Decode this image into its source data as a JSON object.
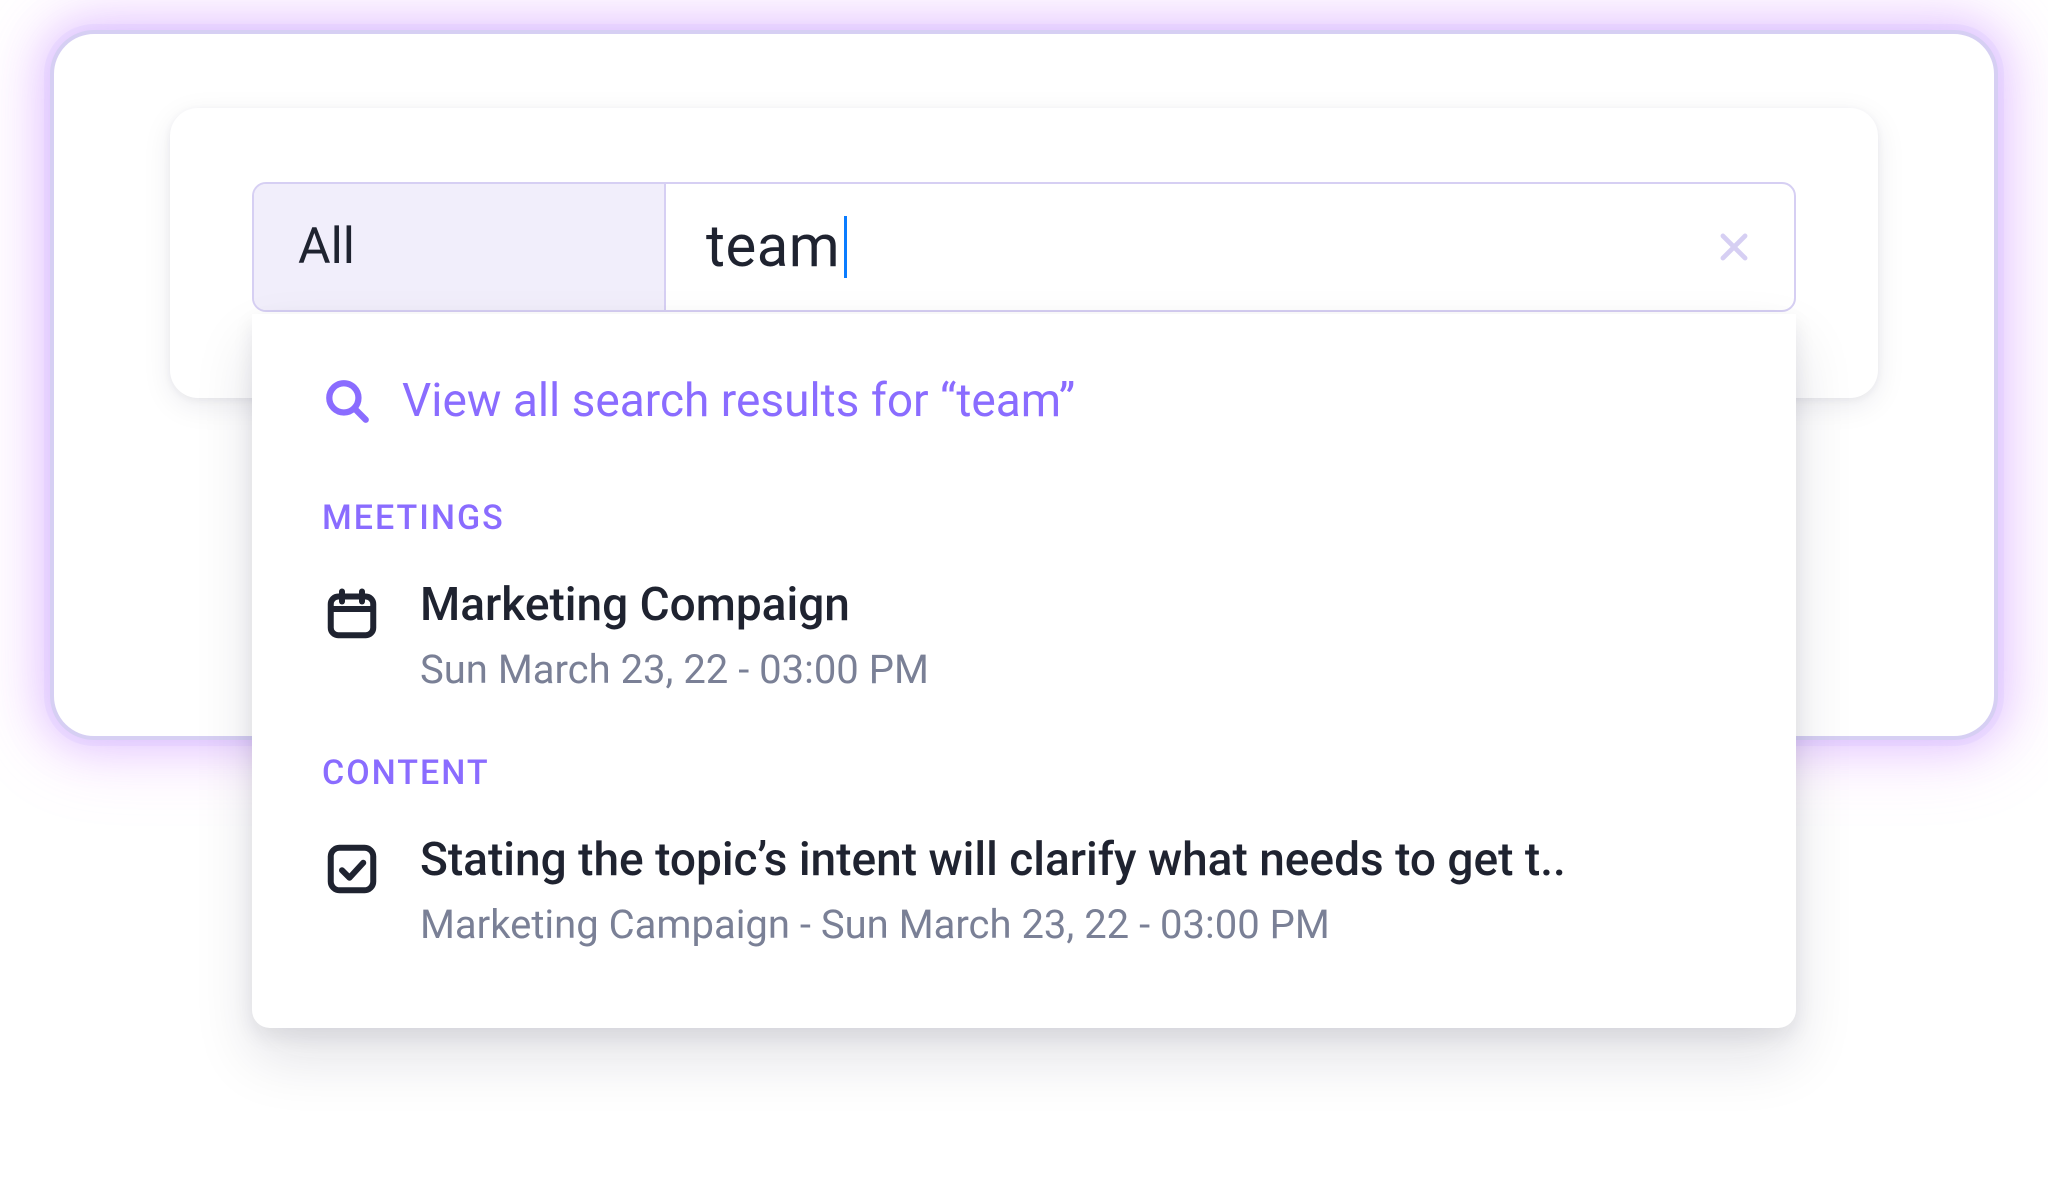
{
  "search": {
    "scope_label": "All",
    "query": "team",
    "view_all_label": "View all search results for “team”"
  },
  "sections": {
    "meetings": {
      "label": "MEETINGS",
      "items": [
        {
          "icon": "calendar-icon",
          "title": "Marketing Compaign",
          "subtitle": "Sun March 23, 22 - 03:00 PM"
        }
      ]
    },
    "content": {
      "label": "CONTENT",
      "items": [
        {
          "icon": "check-square-icon",
          "title": "Stating the topic’s intent will clarify what needs to get t..",
          "subtitle": "Marketing Campaign - Sun March 23, 22 - 03:00 PM"
        }
      ]
    }
  }
}
